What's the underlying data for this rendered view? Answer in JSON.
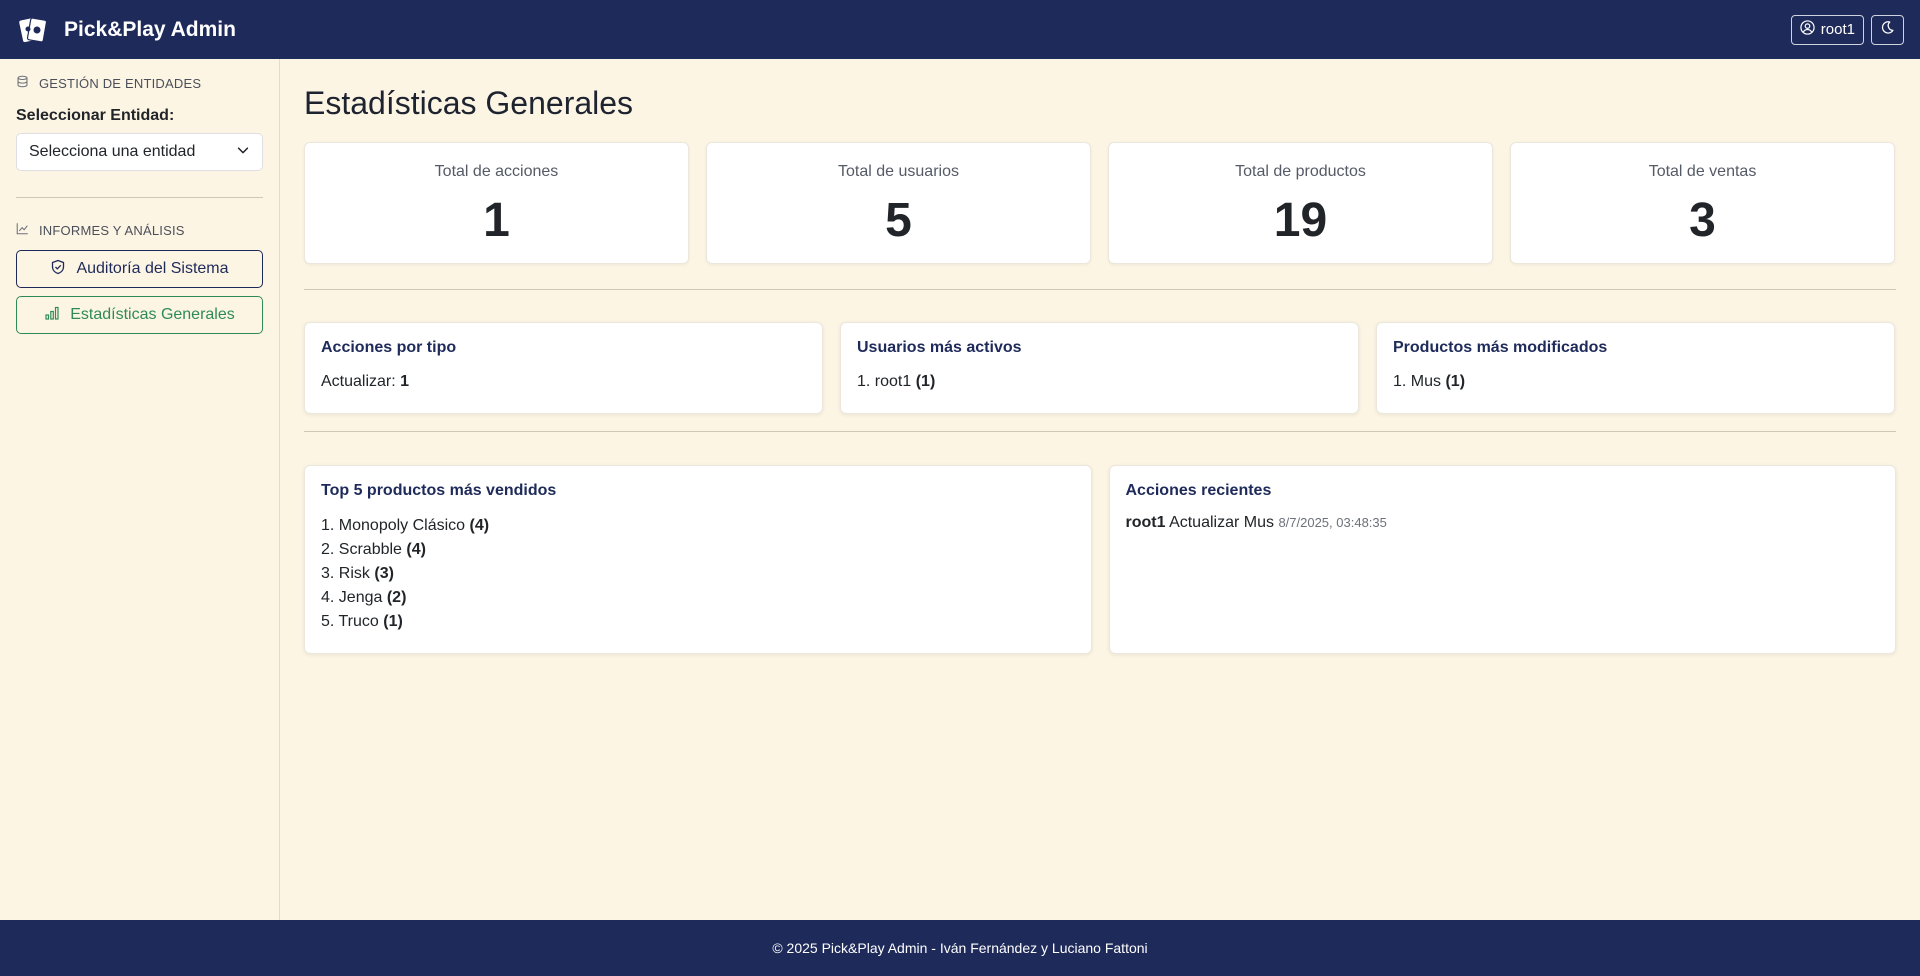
{
  "app": {
    "title": "Pick&Play Admin",
    "user": "root1"
  },
  "sidebar": {
    "entities_heading": "GESTIÓN DE ENTIDADES",
    "select_label": "Seleccionar Entidad:",
    "select_value": "Selecciona una entidad",
    "reports_heading": "INFORMES Y ANÁLISIS",
    "audit_label": "Auditoría del Sistema",
    "stats_label": "Estadísticas Generales"
  },
  "main": {
    "title": "Estadísticas Generales",
    "kpis": [
      {
        "label": "Total de acciones",
        "value": "1"
      },
      {
        "label": "Total de usuarios",
        "value": "5"
      },
      {
        "label": "Total de productos",
        "value": "19"
      },
      {
        "label": "Total de ventas",
        "value": "3"
      }
    ],
    "actions_by_type": {
      "title": "Acciones por tipo",
      "label": "Actualizar:",
      "count": "1"
    },
    "active_users": {
      "title": "Usuarios más activos",
      "label": "1. root1",
      "count": "(1)"
    },
    "modified_products": {
      "title": "Productos más modificados",
      "label": "1. Mus",
      "count": "(1)"
    },
    "top_products": {
      "title": "Top 5 productos más vendidos",
      "items": [
        {
          "label": "1. Monopoly Clásico",
          "count": "(4)"
        },
        {
          "label": "2. Scrabble",
          "count": "(4)"
        },
        {
          "label": "3. Risk",
          "count": "(3)"
        },
        {
          "label": "4. Jenga",
          "count": "(2)"
        },
        {
          "label": "5. Truco",
          "count": "(1)"
        }
      ]
    },
    "recent_actions": {
      "title": "Acciones recientes",
      "user": "root1",
      "action": "Actualizar Mus",
      "date": "8/7/2025, 03:48:35"
    }
  },
  "footer": {
    "text": "© 2025 Pick&Play Admin - Iván Fernández y Luciano Fattoni"
  },
  "icons": {
    "logo": "cards-logo-icon",
    "user": "user-circle-icon",
    "theme": "moon-icon",
    "entities": "database-icon",
    "reports": "line-chart-icon",
    "audit": "shield-icon",
    "stats": "bar-chart-icon",
    "select": "chevron-down-icon"
  },
  "colors": {
    "navy": "#1e2a5a",
    "green": "#2e8b57",
    "cream": "#fdf5e4"
  }
}
